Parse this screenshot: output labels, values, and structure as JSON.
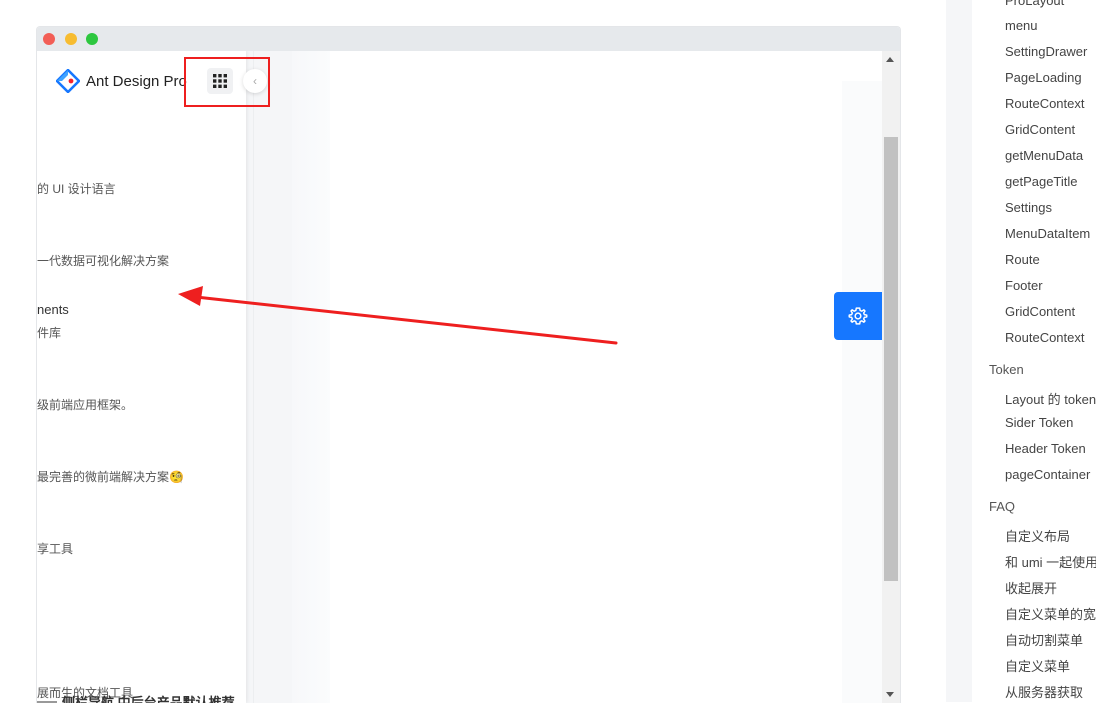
{
  "demo": {
    "app_title": "Ant Design Pro",
    "collapse_glyph": "‹",
    "apps": [
      {
        "desc": "的 UI 设计语言"
      },
      {
        "desc": "一代数据可视化解决方案"
      },
      {
        "title": "nents",
        "desc": "件库"
      },
      {
        "desc": "级前端应用框架。"
      },
      {
        "desc": "最完善的微前端解决方案🧐"
      },
      {
        "desc": "享工具"
      },
      {
        "desc": "展而生的文档工具"
      }
    ],
    "bottom_partial_text": "侧栏导航 中后台产品默认推荐",
    "settings_icon": "gear-icon",
    "accent_color": "#1677ff",
    "highlight_color": "#ee1f1f"
  },
  "doc_nav": {
    "items_top": [
      "ProLayout",
      "menu",
      "SettingDrawer",
      "PageLoading",
      "RouteContext",
      "GridContent",
      "getMenuData",
      "getPageTitle",
      "Settings",
      "MenuDataItem",
      "Route",
      "Footer",
      "GridContent",
      "RouteContext"
    ],
    "token_group": "Token",
    "token_items": [
      "Layout 的 token",
      "Sider Token",
      "Header Token",
      "pageContainer"
    ],
    "faq_group": "FAQ",
    "faq_items": [
      "自定义布局",
      "和 umi 一起使用",
      "收起展开",
      "自定义菜单的宽度",
      "自动切割菜单",
      "自定义菜单",
      "从服务器获取"
    ]
  }
}
